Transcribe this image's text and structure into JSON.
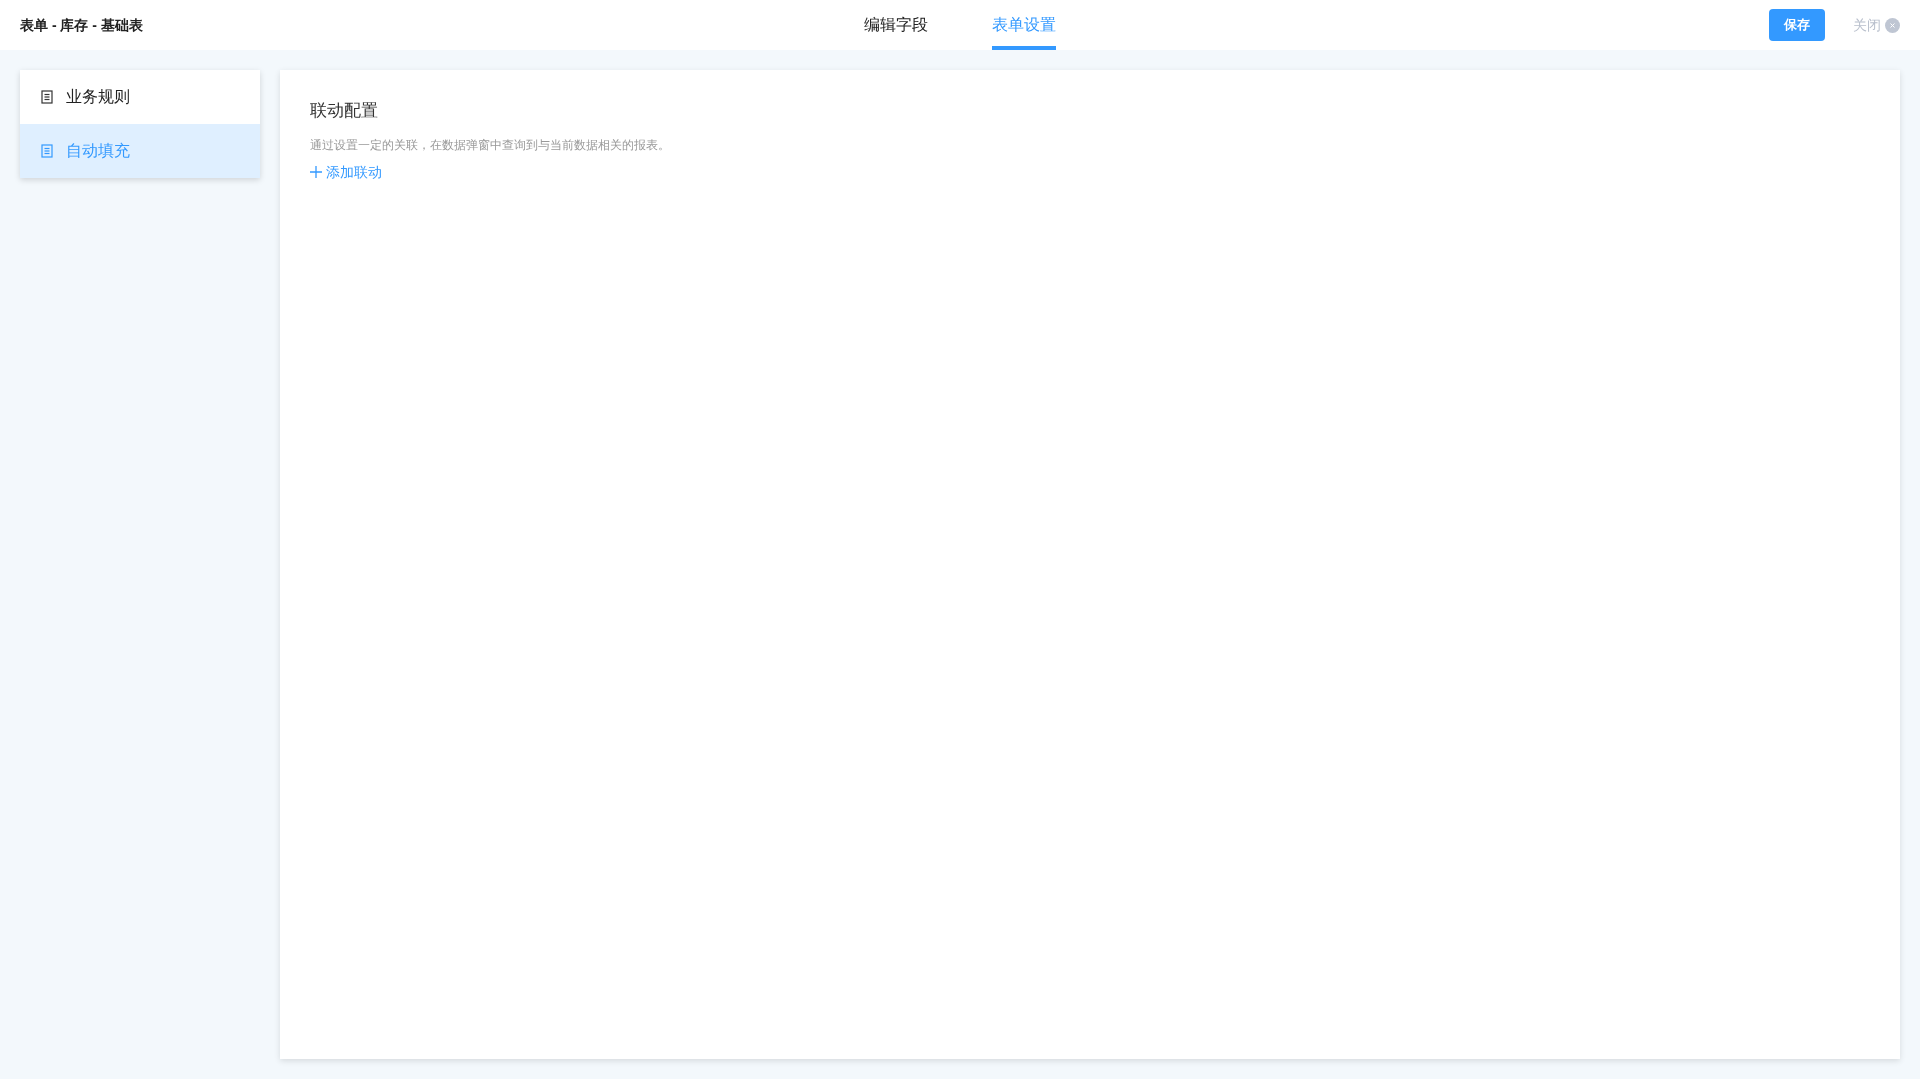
{
  "header": {
    "title": "表单 - 库存 - 基础表",
    "tabs": [
      {
        "label": "编辑字段",
        "selected": false
      },
      {
        "label": "表单设置",
        "selected": true
      }
    ],
    "save_button": "保存",
    "close_button": "关闭"
  },
  "sidebar": {
    "items": [
      {
        "label": "业务规则",
        "selected": false
      },
      {
        "label": "自动填充",
        "selected": true
      }
    ]
  },
  "panel": {
    "title": "联动配置",
    "description": "通过设置一定的关联，在数据弹窗中查询到与当前数据相关的报表。",
    "add_link": "添加联动"
  }
}
